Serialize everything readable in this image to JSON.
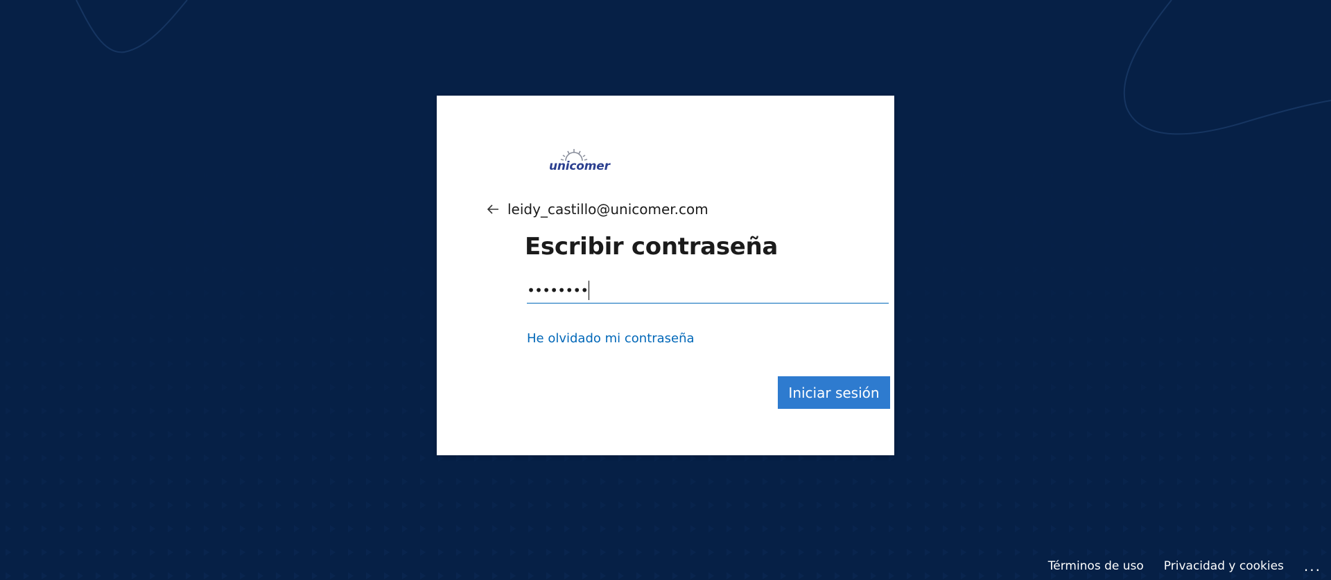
{
  "colors": {
    "background": "#062046",
    "card": "#ffffff",
    "accent": "#0067b8",
    "button": "#2e7bcf",
    "text": "#1b1b1b",
    "logo": "#2b3f8f"
  },
  "logo": {
    "text": "unicomer",
    "icon": "sun-logo-icon"
  },
  "identity": {
    "icon": "back-arrow-icon",
    "email": "leidy_castillo@unicomer.com"
  },
  "title": "Escribir contraseña",
  "password": {
    "masked_value": "••••••••"
  },
  "forgot_link": "He olvidado mi contraseña",
  "signin_button": "Iniciar sesión",
  "footer": {
    "terms": "Términos de uso",
    "privacy": "Privacidad y cookies",
    "more": "..."
  }
}
